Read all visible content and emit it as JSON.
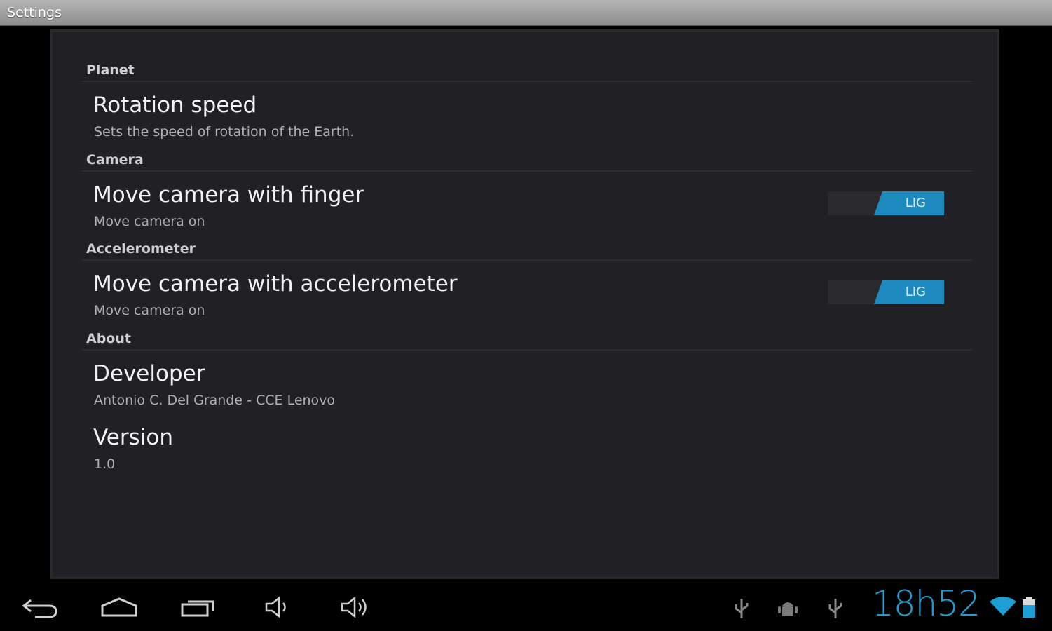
{
  "window": {
    "title": "Settings"
  },
  "categories": {
    "planet": "Planet",
    "camera": "Camera",
    "accelerometer": "Accelerometer",
    "about": "About"
  },
  "prefs": {
    "rotation": {
      "title": "Rotation speed",
      "summary": "Sets the speed of rotation of the Earth."
    },
    "finger": {
      "title": "Move camera with finger",
      "summary": "Move camera on",
      "toggle_label": "LIG",
      "toggle_state": "on"
    },
    "accel": {
      "title": "Move camera with accelerometer",
      "summary": "Move camera on",
      "toggle_label": "LIG",
      "toggle_state": "on"
    },
    "developer": {
      "title": "Developer",
      "summary": "Antonio C. Del Grande - CCE Lenovo"
    },
    "version": {
      "title": "Version",
      "summary": "1.0"
    }
  },
  "statusbar": {
    "time": "18h52",
    "icons": [
      "usb-icon",
      "android-debug-icon",
      "usb-icon",
      "wifi-icon",
      "battery-icon"
    ]
  },
  "navbar": {
    "icons": [
      "back-icon",
      "home-icon",
      "recent-apps-icon",
      "volume-down-icon",
      "volume-up-icon"
    ]
  },
  "colors": {
    "accent": "#1d8bbf",
    "clock": "#1d9fd6",
    "panel": "#212125"
  }
}
